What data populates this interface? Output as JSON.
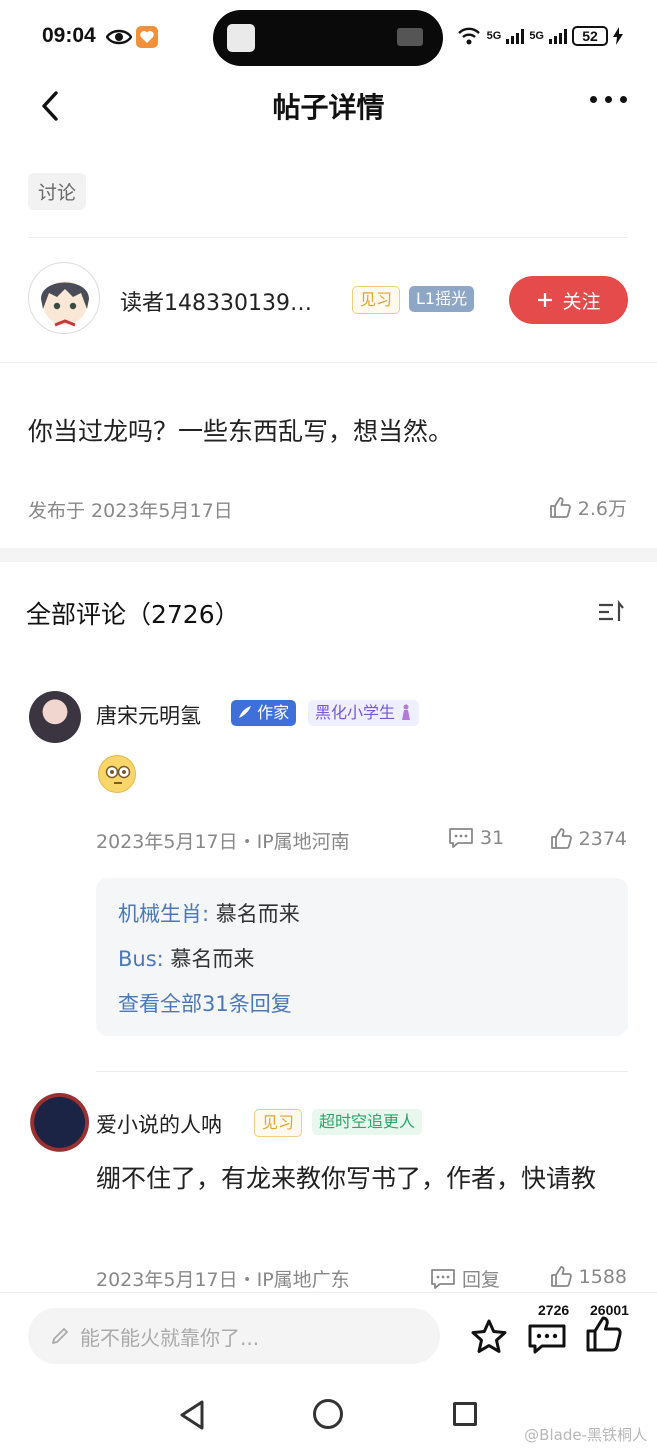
{
  "status_bar": {
    "time": "09:04",
    "signal1": "5G",
    "signal2": "5G",
    "battery": "52"
  },
  "header": {
    "title": "帖子详情"
  },
  "post": {
    "tag": "讨论",
    "author": {
      "name": "读者148330139…",
      "badge_level": "见习",
      "badge_rank": "L1摇光"
    },
    "follow_label": "关注",
    "text": "你当过龙吗？一些东西乱写，想当然。",
    "date": "发布于 2023年5月17日",
    "likes": "2.6万"
  },
  "comments_section": {
    "title": "全部评论（2726）"
  },
  "comments": [
    {
      "name": "唐宋元明氢",
      "badge_writer": "作家",
      "badge_title": "黑化小学生",
      "meta": "2023年5月17日・IP属地河南",
      "replies": "31",
      "likes": "2374",
      "reply_preview": [
        {
          "user": "机械生肖:",
          "text": " 慕名而来"
        },
        {
          "user": "Bus:",
          "text": " 慕名而来"
        }
      ],
      "view_all": "查看全部31条回复"
    },
    {
      "name": "爱小说的人呐",
      "badge_level": "见习",
      "badge_title": "超时空追更人",
      "text": "绷不住了，有龙来教你写书了，作者，快请教",
      "meta": "2023年5月17日・IP属地广东",
      "reply_label": "回复",
      "likes": "1588"
    }
  ],
  "bottom_bar": {
    "input_placeholder": "能不能火就靠你了...",
    "comment_count": "2726",
    "like_count": "26001"
  },
  "watermark": "@Blade-黑铁桐人",
  "colors": {
    "follow_button": "#e54b4b",
    "link_blue": "#4a78b8",
    "meta_gray": "#888888"
  }
}
